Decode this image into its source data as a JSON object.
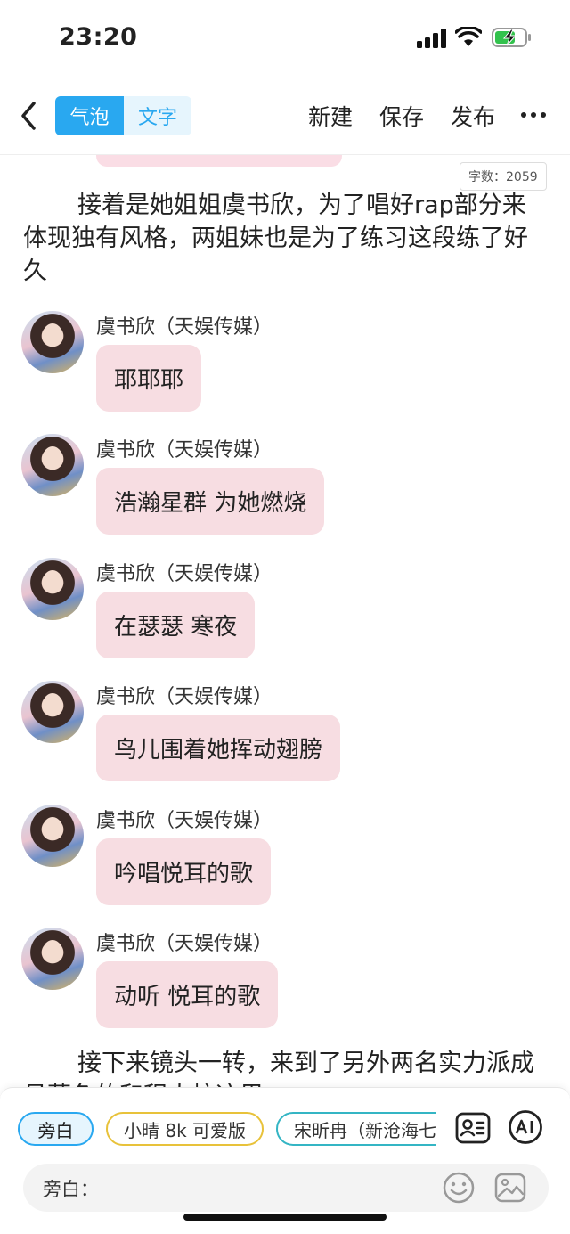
{
  "status_bar": {
    "time": "23:20"
  },
  "nav": {
    "mode_bubble": "气泡",
    "mode_text": "文字",
    "new_label": "新建",
    "save_label": "保存",
    "publish_label": "发布"
  },
  "content": {
    "word_count": "字数：2059",
    "narration_1": "接着是她姐姐虞书欣，为了唱好rap部分来体现独有风格，两姐妹也是为了练习这段练了好久",
    "narration_2": "接下来镜头一转，来到了另外两名实力派成员慕鱼的和程大校这里",
    "messages": [
      {
        "sender": "虞书欣（天娱传媒）",
        "text": "耶耶耶"
      },
      {
        "sender": "虞书欣（天娱传媒）",
        "text": "浩瀚星群 为她燃烧"
      },
      {
        "sender": "虞书欣（天娱传媒）",
        "text": "在瑟瑟 寒夜"
      },
      {
        "sender": "虞书欣（天娱传媒）",
        "text": "鸟儿围着她挥动翅膀"
      },
      {
        "sender": "虞书欣（天娱传媒）",
        "text": "吟唱悦耳的歌"
      },
      {
        "sender": "虞书欣（天娱传媒）",
        "text": "动听 悦耳的歌"
      }
    ]
  },
  "bottom": {
    "chips": [
      "旁白",
      "小晴 8k 可爱版",
      "宋昕冉（新沧海七"
    ],
    "input_label": "旁白："
  },
  "colors": {
    "accent": "#29a8f0",
    "bubble": "#f7dde2"
  },
  "icons": [
    "signal-icon",
    "wifi-icon",
    "battery-icon",
    "back-icon",
    "more-icon",
    "contacts-icon",
    "ai-icon",
    "emoji-icon",
    "image-icon"
  ]
}
